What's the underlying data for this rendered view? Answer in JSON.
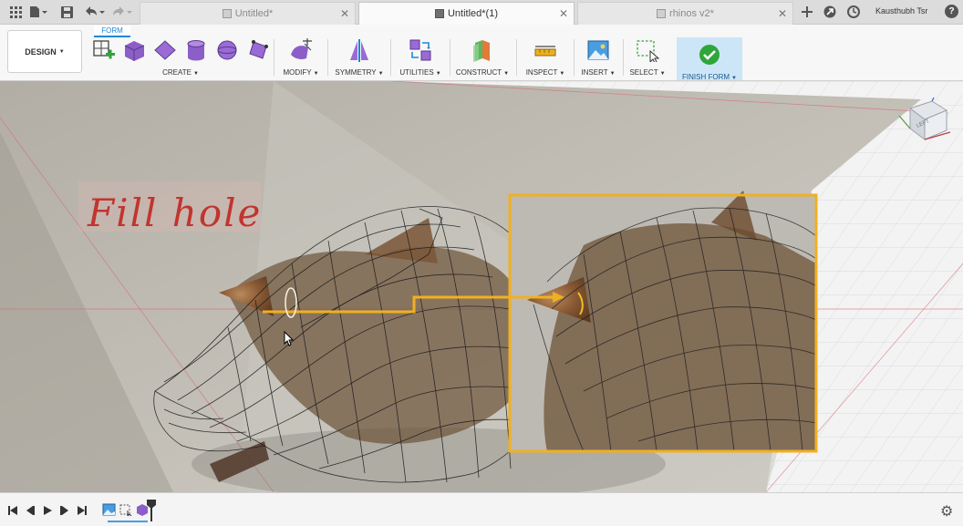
{
  "tabs": [
    {
      "label": "Untitled*",
      "active": false
    },
    {
      "label": "Untitled*(1)",
      "active": true
    },
    {
      "label": "rhinos v2*",
      "active": false
    }
  ],
  "user": {
    "name": "Kausthubh Tsr"
  },
  "workspace": {
    "label": "DESIGN"
  },
  "mode_tab": {
    "label": "FORM"
  },
  "toolbar": {
    "groups": [
      {
        "label": "CREATE"
      },
      {
        "label": "MODIFY"
      },
      {
        "label": "SYMMETRY"
      },
      {
        "label": "UTILITIES"
      },
      {
        "label": "CONSTRUCT"
      },
      {
        "label": "INSPECT"
      },
      {
        "label": "INSERT"
      },
      {
        "label": "SELECT"
      }
    ],
    "finish": {
      "label": "FINISH FORM"
    }
  },
  "viewport": {
    "annotation": "Fill hole",
    "viewcube_face": "LEFT"
  },
  "colors": {
    "accent": "#1e87d8",
    "highlight": "#f0b020",
    "annotation": "#c0352e",
    "finish_bg": "#cde6f7",
    "finish_check": "#2ea63a"
  }
}
